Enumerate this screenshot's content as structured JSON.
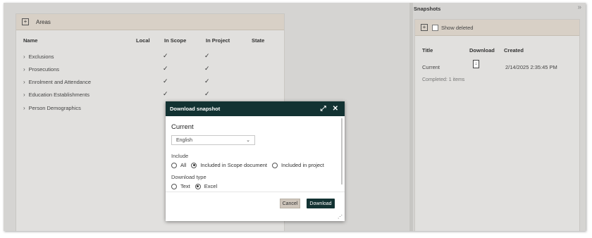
{
  "areas": {
    "title": "Areas",
    "columns": [
      "Name",
      "Local",
      "In Scope",
      "In Project",
      "State"
    ],
    "rows": [
      {
        "name": "Exclusions",
        "in_scope": "✓",
        "in_project": "✓"
      },
      {
        "name": "Prosecutions",
        "in_scope": "✓",
        "in_project": "✓"
      },
      {
        "name": "Enrolment and Attendance",
        "in_scope": "✓",
        "in_project": "✓"
      },
      {
        "name": "Education Establishments",
        "in_scope": "✓",
        "in_project": "✓"
      },
      {
        "name": "Person Demographics",
        "in_scope": "",
        "in_project": ""
      }
    ]
  },
  "snapshots": {
    "title": "Snapshots",
    "show_deleted_label": "Show deleted",
    "columns": {
      "title": "Title",
      "download": "Download",
      "created": "Created"
    },
    "rows": [
      {
        "title": "Current",
        "created": "2/14/2025 2:35:45 PM"
      }
    ],
    "completed_text": "Completed: 1 items"
  },
  "modal": {
    "title": "Download snapshot",
    "subtitle": "Current",
    "language": "English",
    "include_label": "Include",
    "include_options": [
      "All",
      "Included in Scope document",
      "Included in project"
    ],
    "include_selected": 1,
    "download_type_label": "Download type",
    "download_type_options": [
      "Text",
      "Excel"
    ],
    "download_type_selected": 1,
    "cancel_label": "Cancel",
    "download_label": "Download"
  }
}
